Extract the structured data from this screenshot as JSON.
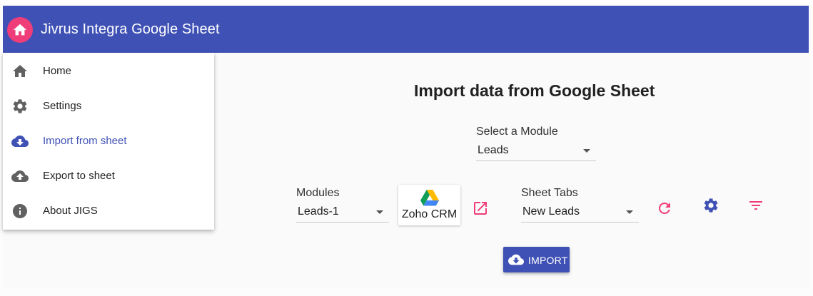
{
  "app": {
    "title": "Jivrus Integra Google Sheet",
    "brand_color": "#3f51b5",
    "accent_color": "#ef3d79"
  },
  "sidebar": {
    "items": [
      {
        "label": "Home",
        "icon": "home-icon",
        "active": false
      },
      {
        "label": "Settings",
        "icon": "gear-icon",
        "active": false
      },
      {
        "label": "Import from sheet",
        "icon": "cloud-download-icon",
        "active": true
      },
      {
        "label": "Export to sheet",
        "icon": "cloud-upload-icon",
        "active": false
      },
      {
        "label": "About JIGS",
        "icon": "info-icon",
        "active": false
      }
    ]
  },
  "main": {
    "heading": "Import data from Google Sheet",
    "module_select": {
      "label": "Select a Module",
      "value": "Leads"
    },
    "modules_select": {
      "label": "Modules",
      "value": "Leads-1"
    },
    "crm_card": {
      "label": "Zoho CRM",
      "icon": "google-drive-icon"
    },
    "sheet_tabs_select": {
      "label": "Sheet Tabs",
      "value": "New Leads"
    },
    "actions": {
      "open_external_icon": "open-in-new-icon",
      "refresh_icon": "refresh-icon",
      "settings_icon": "gear-icon",
      "filter_icon": "filter-icon"
    },
    "import_button": {
      "label": "IMPORT",
      "icon": "cloud-download-icon"
    }
  }
}
